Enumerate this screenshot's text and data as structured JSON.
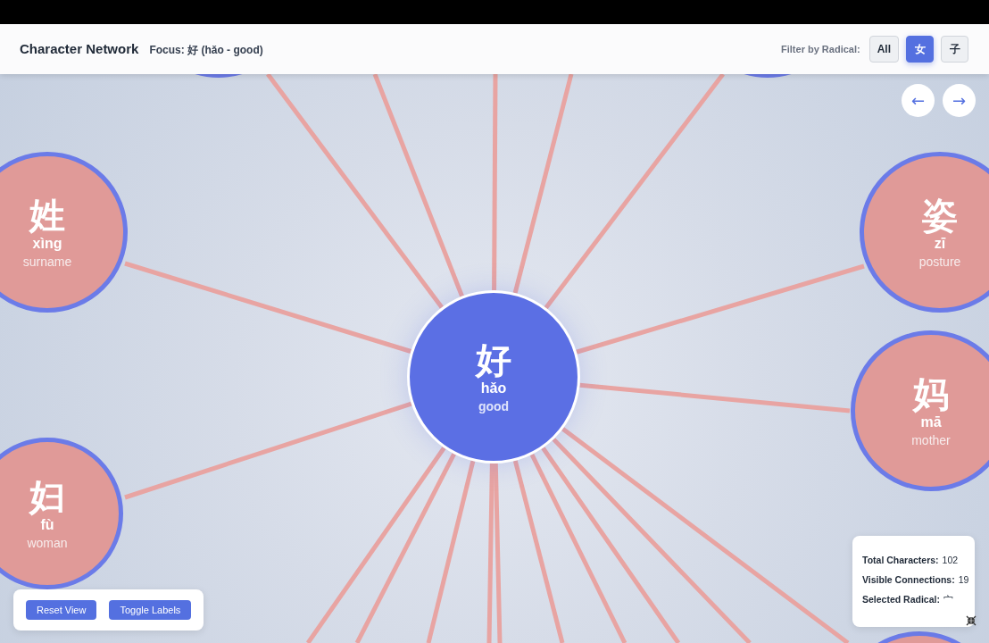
{
  "header": {
    "title": "Character Network",
    "focus": "Focus: 好 (hǎo - good)",
    "filter_label": "Filter by Radical:",
    "filters": [
      {
        "label": "All",
        "selected": false
      },
      {
        "label": "女",
        "selected": true
      },
      {
        "label": "子",
        "selected": false
      }
    ]
  },
  "nav": [
    "←",
    "→"
  ],
  "nodes": [
    {
      "kind": "focus",
      "character": "好",
      "pinyin": "hǎo",
      "meaning": "good"
    },
    {
      "kind": "related",
      "character": "姓",
      "pinyin": "xìng",
      "meaning": "surname"
    },
    {
      "kind": "related",
      "character": "姿",
      "pinyin": "zī",
      "meaning": "posture"
    },
    {
      "kind": "related",
      "character": "妈",
      "pinyin": "mā",
      "meaning": "mother"
    },
    {
      "kind": "related",
      "character": "妇",
      "pinyin": "fù",
      "meaning": "woman"
    },
    {
      "kind": "related"
    },
    {
      "kind": "related"
    },
    {
      "kind": "related"
    }
  ],
  "controls": [
    "Reset View",
    "Toggle Labels"
  ],
  "stats": [
    {
      "label": "Total Characters:",
      "value": "102"
    },
    {
      "label": "Visible Connections:",
      "value": "19"
    },
    {
      "label": "Selected Radical:",
      "value": "宀"
    }
  ]
}
